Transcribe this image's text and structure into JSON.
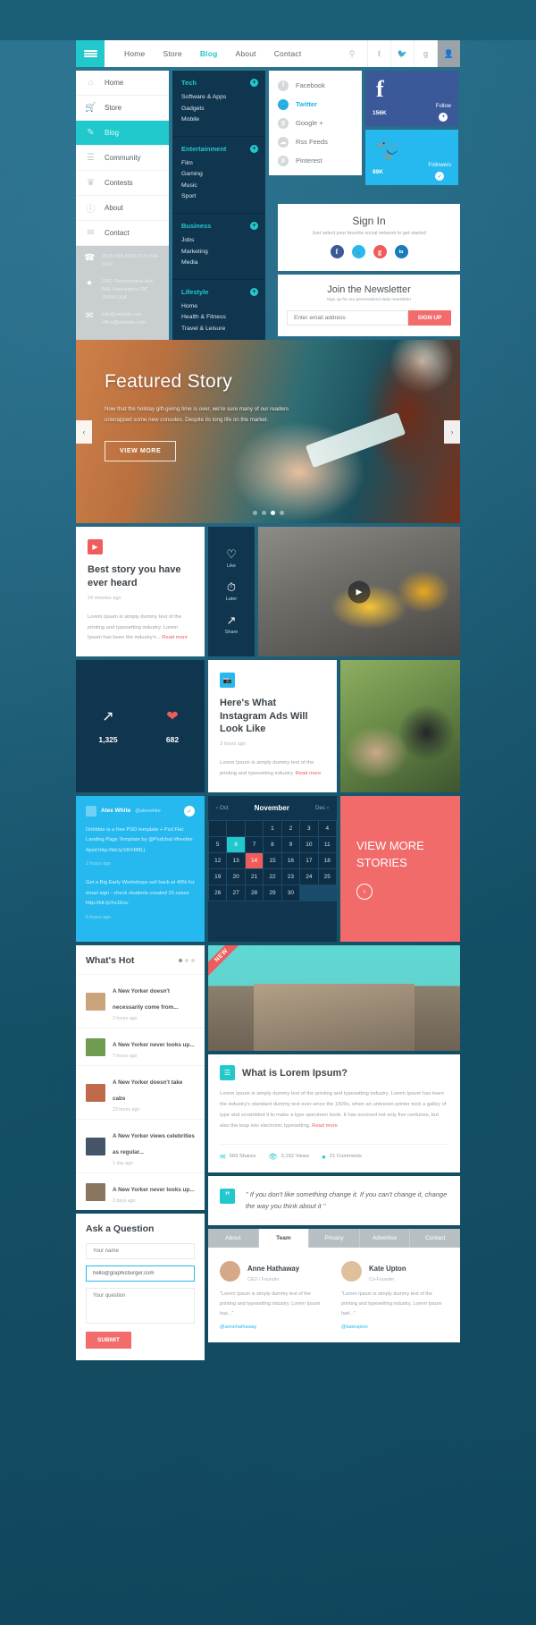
{
  "topbar": {
    "menu_icon": "hamburger-icon",
    "links": [
      {
        "label": "Home",
        "active": false
      },
      {
        "label": "Store",
        "active": false
      },
      {
        "label": "Blog",
        "active": true
      },
      {
        "label": "About",
        "active": false
      },
      {
        "label": "Contact",
        "active": false
      }
    ],
    "icons": [
      "search-icon",
      "facebook-icon",
      "twitter-icon",
      "google-plus-icon",
      "user-icon"
    ]
  },
  "vertical_menu": {
    "items": [
      {
        "label": "Home",
        "icon": "home-icon",
        "active": false
      },
      {
        "label": "Store",
        "icon": "cart-icon",
        "active": false
      },
      {
        "label": "Blog",
        "icon": "edit-icon",
        "active": true
      },
      {
        "label": "Community",
        "icon": "people-icon",
        "active": false
      },
      {
        "label": "Contests",
        "icon": "trophy-icon",
        "active": false
      },
      {
        "label": "About",
        "icon": "info-icon",
        "active": false
      },
      {
        "label": "Contact",
        "icon": "mail-icon",
        "active": false
      }
    ],
    "contact": {
      "phone": "(813) 559-3238\n(319) 504-5619",
      "address": "1002 Pennsylvania Ave NW, Washington, DC 20004 USA",
      "email": "info@website.com\noffice@website.com"
    }
  },
  "mega_menu": {
    "sections": [
      {
        "title": "Tech",
        "links": [
          "Software & Apps",
          "Gadgets",
          "Mobile"
        ]
      },
      {
        "title": "Entertainment",
        "links": [
          "Film",
          "Gaming",
          "Music",
          "Sport"
        ]
      },
      {
        "title": "Business",
        "links": [
          "Jobs",
          "Marketing",
          "Media"
        ]
      },
      {
        "title": "Lifestyle",
        "links": [
          "Home",
          "Health & Fitness",
          "Travel & Leisure"
        ]
      }
    ]
  },
  "social_list": {
    "items": [
      {
        "label": "Facebook",
        "glyph": "f",
        "active": false
      },
      {
        "label": "Twitter",
        "glyph": "t",
        "active": true
      },
      {
        "label": "Google +",
        "glyph": "g",
        "active": false
      },
      {
        "label": "Rss Feeds",
        "glyph": "r",
        "active": false
      },
      {
        "label": "Pinterest",
        "glyph": "p",
        "active": false
      }
    ]
  },
  "social_cards": [
    {
      "network": "facebook",
      "glyph": "f",
      "count": "156K",
      "action": "Follow",
      "color": "#3b5998"
    },
    {
      "network": "twitter",
      "glyph": "t",
      "count": "89K",
      "action": "Followers",
      "color": "#25b9ef"
    }
  ],
  "signin": {
    "title": "Sign In",
    "subtitle": "Just select your favorite social network to get started",
    "buttons": [
      {
        "name": "facebook",
        "glyph": "f",
        "color": "#3b5998"
      },
      {
        "name": "twitter",
        "glyph": "t",
        "color": "#25b9ef"
      },
      {
        "name": "google-plus",
        "glyph": "g",
        "color": "#f05b5b"
      },
      {
        "name": "linkedin",
        "glyph": "in",
        "color": "#1a7bb9"
      }
    ]
  },
  "newsletter": {
    "title": "Join the Newsletter",
    "subtitle": "Sign up for our personalized daily newsletter",
    "placeholder": "Enter email address",
    "button": "SIGN UP"
  },
  "featured": {
    "title": "Featured Story",
    "body": "Now that the holiday gift-giving time is over, we're sure many of our readers unwrapped some new consoles. Despite its long life on the market.",
    "cta": "VIEW MORE",
    "prev": "‹",
    "next": "›",
    "dots": 4,
    "active_dot": 2
  },
  "story_card": {
    "icon": "video-icon",
    "title": "Best story you have ever heard",
    "time": "24 minutes ago",
    "body": "Lorem Ipsum is simply dummy text of the printing and typesetting industry. Lorem Ipsum has been the industry's...",
    "read_more": "Read more",
    "actions": [
      {
        "label": "Like",
        "icon": "heart-icon"
      },
      {
        "label": "Later",
        "icon": "clock-icon"
      },
      {
        "label": "Share",
        "icon": "share-icon"
      }
    ],
    "play_icon": "play-icon"
  },
  "stats_card": {
    "shares_icon": "share-icon",
    "shares": "1,325",
    "likes_icon": "heart-icon",
    "likes": "682"
  },
  "instagram_card": {
    "icon": "camera-icon",
    "title": "Here's What Instagram Ads Will Look Like",
    "time": "3 hours ago",
    "body": "Lorem Ipsum is simply dummy text of the printing and typesetting industry.",
    "read_more": "Read more"
  },
  "twitter_feed": {
    "name": "Alex White",
    "handle": "@alexwhite",
    "verified_icon": "check-icon",
    "tweets": [
      {
        "text": "Dribbble is a free PSD template + Psd Flat Landing Page Template by @Psdchat #freebie #psd http://bit.ly/1RXM8Lj",
        "time": "2 hours ago"
      },
      {
        "text": "Get a Big Early Workshops sell back at 40% for email sign - check students created 25 cases http://bit.ly/Xx1Esc",
        "time": "5 hours ago"
      }
    ]
  },
  "calendar": {
    "prev_label": "Oct",
    "month": "November",
    "next_label": "Dec",
    "leading_blanks": 3,
    "days": [
      1,
      2,
      3,
      4,
      5,
      6,
      7,
      8,
      9,
      10,
      11,
      12,
      13,
      14,
      15,
      16,
      17,
      18,
      19,
      20,
      21,
      22,
      23,
      24,
      25,
      26,
      27,
      28,
      29,
      30
    ],
    "highlight_teal": 6,
    "highlight_red": 14
  },
  "view_more": {
    "title": "VIEW MORE STORIES",
    "arrow": "›"
  },
  "whats_hot": {
    "title": "What's Hot",
    "items": [
      {
        "text": "A New Yorker doesn't necessarily come from...",
        "time": "3 hours ago",
        "thumb": "#caa37c"
      },
      {
        "text": "A New Yorker never looks up...",
        "time": "7 hours ago",
        "thumb": "#6f9c4e"
      },
      {
        "text": "A New Yorker doesn't take cabs",
        "time": "23 hours ago",
        "thumb": "#c06a4a"
      },
      {
        "text": "A New Yorker views celebrities as regular...",
        "time": "1 day ago",
        "thumb": "#46546a"
      },
      {
        "text": "A New Yorker never looks up...",
        "time": "2 days ago",
        "thumb": "#8a7560"
      }
    ]
  },
  "ask_question": {
    "title": "Ask a Question",
    "name_placeholder": "Your name",
    "email_value": "hello@graphicburger.com",
    "question_placeholder": "Your question",
    "submit": "SUBMIT"
  },
  "article": {
    "ribbon": "NEW",
    "icon": "document-icon",
    "title": "What is Lorem Ipsum?",
    "body": "Lorem Ipsum is simply dummy text of the printing and typesetting industry. Lorem Ipsum has been the industry's standard dummy text ever since the 1500s, when an unknown printer took a galley of type and scrambled it to make a type specimen book. It has survived not only five centuries, but also the leap into electronic typesetting.",
    "read_more": "Read more",
    "meta": [
      {
        "icon": "share-icon",
        "label": "569 Shares"
      },
      {
        "icon": "eye-icon",
        "label": "3,152 Views"
      },
      {
        "icon": "comment-icon",
        "label": "21 Comments"
      }
    ]
  },
  "quote": {
    "mark": "”",
    "text": "\" If you don't like something change it. If you can't change it, change the way you think about it \""
  },
  "tabs_section": {
    "tabs": [
      {
        "label": "About",
        "active": false
      },
      {
        "label": "Team",
        "active": true
      },
      {
        "label": "Privacy",
        "active": false
      },
      {
        "label": "Advertise",
        "active": false
      },
      {
        "label": "Contact",
        "active": false
      }
    ],
    "members": [
      {
        "name": "Anne Hathaway",
        "role": "CEO / Founder",
        "bio": "\"Lorem Ipsum is simply dummy text of the printing and typesetting industry. Lorem Ipsum has...\"",
        "handle": "@annehathaway",
        "avatar": "#d6a88a"
      },
      {
        "name": "Kate Upton",
        "role": "Co-Founder",
        "bio": "\"Lorem Ipsum is simply dummy text of the printing and typesetting industry. Lorem Ipsum had...\"",
        "handle": "@kateupton",
        "avatar": "#e0c09a"
      }
    ]
  },
  "colors": {
    "teal": "#22c9cc",
    "blue": "#25b9ef",
    "red": "#f05b5b",
    "navy": "#10354f",
    "bg": "#1b5e77"
  }
}
